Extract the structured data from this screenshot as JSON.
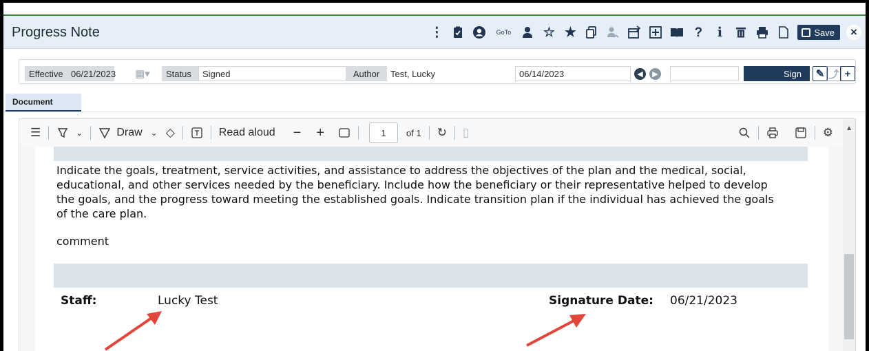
{
  "window": {
    "title": "Progress Note",
    "goto_label": "GoTo",
    "save_label": "Save",
    "close_glyph": "×"
  },
  "header": {
    "effective_label": "Effective",
    "effective_value": "06/21/2023",
    "status_label": "Status",
    "status_value": "Signed",
    "author_label": "Author",
    "author_value": "Test, Lucky",
    "date_value": "06/14/2023",
    "sign_label": "Sign"
  },
  "tabs": [
    {
      "label": "Document"
    }
  ],
  "pdf_toolbar": {
    "draw_label": "Draw",
    "read_aloud_label": "Read aloud",
    "page_number": "1",
    "page_of": "of 1"
  },
  "document": {
    "goals_text": "Indicate the goals, treatment, service activities, and assistance to address the objectives of the plan and the medical, social, educational, and other services needed by the beneficiary. Include how the beneficiary or their representative helped to develop the goals, and the progress toward meeting the established goals. Indicate transition plan if the individual has achieved the goals of the care plan.",
    "comment_text": "comment",
    "staff_label": "Staff:",
    "staff_value": "Lucky Test",
    "signature_date_label": "Signature Date:",
    "signature_date_value": "06/21/2023"
  },
  "colors": {
    "accent": "#1f3a5a",
    "title_bar": "#e6eff7",
    "top_line": "#3a8a3a",
    "annotation_arrow": "#e2453a"
  },
  "icons": [
    "kebab-menu-icon",
    "clipboard-check-icon",
    "user-circle-icon",
    "goto-icon",
    "person-icon",
    "star-outline-icon",
    "star-filled-icon",
    "copy-icon",
    "user-share-icon",
    "calendar-edit-icon",
    "add-box-icon",
    "book-icon",
    "help-icon",
    "info-icon",
    "trash-icon",
    "print-icon",
    "document-icon",
    "save-icon",
    "close-icon"
  ]
}
